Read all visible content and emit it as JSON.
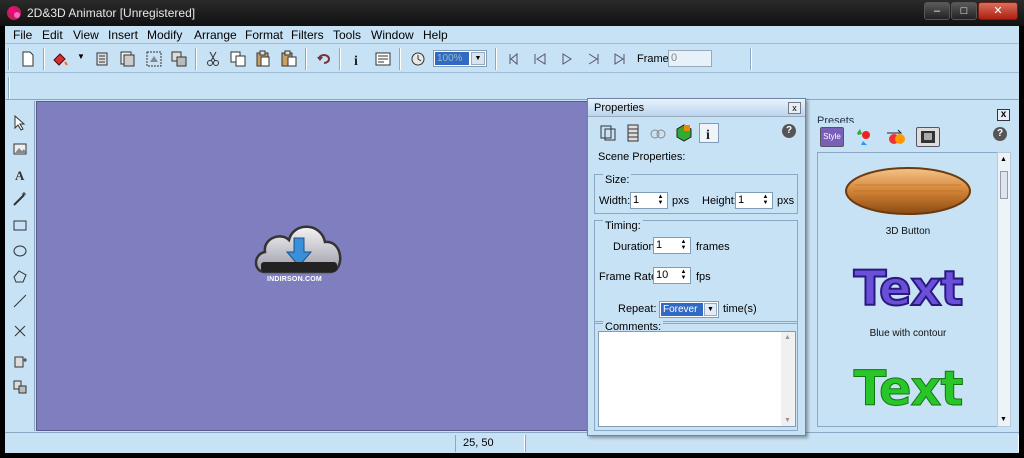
{
  "window": {
    "title": "2D&3D Animator [Unregistered]",
    "buttons": {
      "minimize": "–",
      "maximize": "□",
      "close": "✕"
    }
  },
  "menu": [
    "File",
    "Edit",
    "View",
    "Insert",
    "Modify",
    "Arrange",
    "Format",
    "Filters",
    "Tools",
    "Window",
    "Help"
  ],
  "toolbar": {
    "zoom_value": "100%",
    "frame_label": "Frame:",
    "frame_value": "0"
  },
  "canvas": {
    "background": "#7f7fc0",
    "logo_text": "INDIRSON.COM"
  },
  "status": {
    "coords": "25, 50"
  },
  "properties": {
    "title": "Properties",
    "close": "x",
    "help": "?",
    "section_title": "Scene Properties:",
    "size": {
      "group_label": "Size:",
      "width_label": "Width:",
      "width_value": "1",
      "width_unit": "pxs",
      "height_label": "Height:",
      "height_value": "1",
      "height_unit": "pxs"
    },
    "timing": {
      "group_label": "Timing:",
      "duration_label": "Duration:",
      "duration_value": "1",
      "duration_unit": "frames",
      "framerate_label": "Frame Rate:",
      "framerate_value": "10",
      "framerate_unit": "fps",
      "repeat_label": "Repeat:",
      "repeat_value": "Forever",
      "repeat_unit": "time(s)"
    },
    "comments_label": "Comments:"
  },
  "presets": {
    "title": "Presets",
    "close": "x",
    "help": "?",
    "tab_style": "Style",
    "items": [
      {
        "caption": "3D Button"
      },
      {
        "text": "Text",
        "caption": "Blue with contour"
      },
      {
        "text": "Text"
      }
    ]
  }
}
